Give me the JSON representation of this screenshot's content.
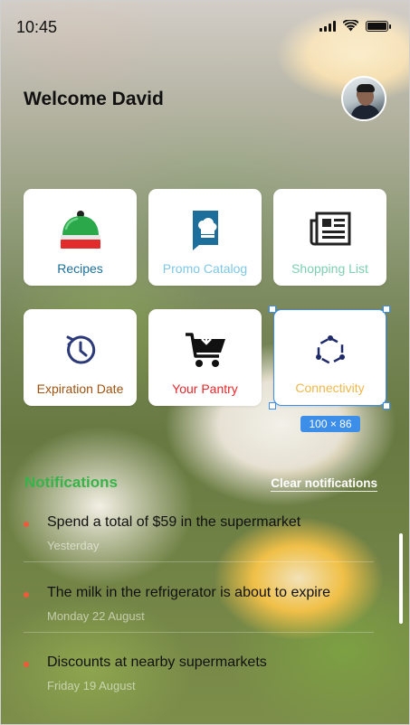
{
  "status_bar": {
    "time": "10:45"
  },
  "header": {
    "welcome": "Welcome David"
  },
  "tiles": [
    {
      "label": "Recipes",
      "color": "#1b6f9a",
      "icon": "chef-hat-icon"
    },
    {
      "label": "Promo Catalog",
      "color": "#7ec7e6",
      "icon": "catalog-book-icon"
    },
    {
      "label": "Shopping List",
      "color": "#7ccfb0",
      "icon": "newspaper-list-icon"
    },
    {
      "label": "Expiration Date",
      "color": "#a0520f",
      "icon": "clock-rewind-icon"
    },
    {
      "label": "Your Pantry",
      "color": "#e8262a",
      "icon": "shopping-cart-icon"
    },
    {
      "label": "Connectivity",
      "color": "#f0b74a",
      "icon": "hexagon-connect-icon"
    }
  ],
  "selection": {
    "dimensions": "100 × 86"
  },
  "notifications": {
    "title": "Notifications",
    "clear_label": "Clear notifications",
    "items": [
      {
        "text": "Spend a total of $59 in the supermarket",
        "date": "Yesterday"
      },
      {
        "text": "The milk in the refrigerator is about to expire",
        "date": "Monday 22 August"
      },
      {
        "text": "Discounts at nearby supermarkets",
        "date": "Friday 19 August"
      }
    ]
  },
  "colors": {
    "accent_green": "#37b34a",
    "bullet": "#f05a3a",
    "selection_blue": "#3d8ee8"
  }
}
